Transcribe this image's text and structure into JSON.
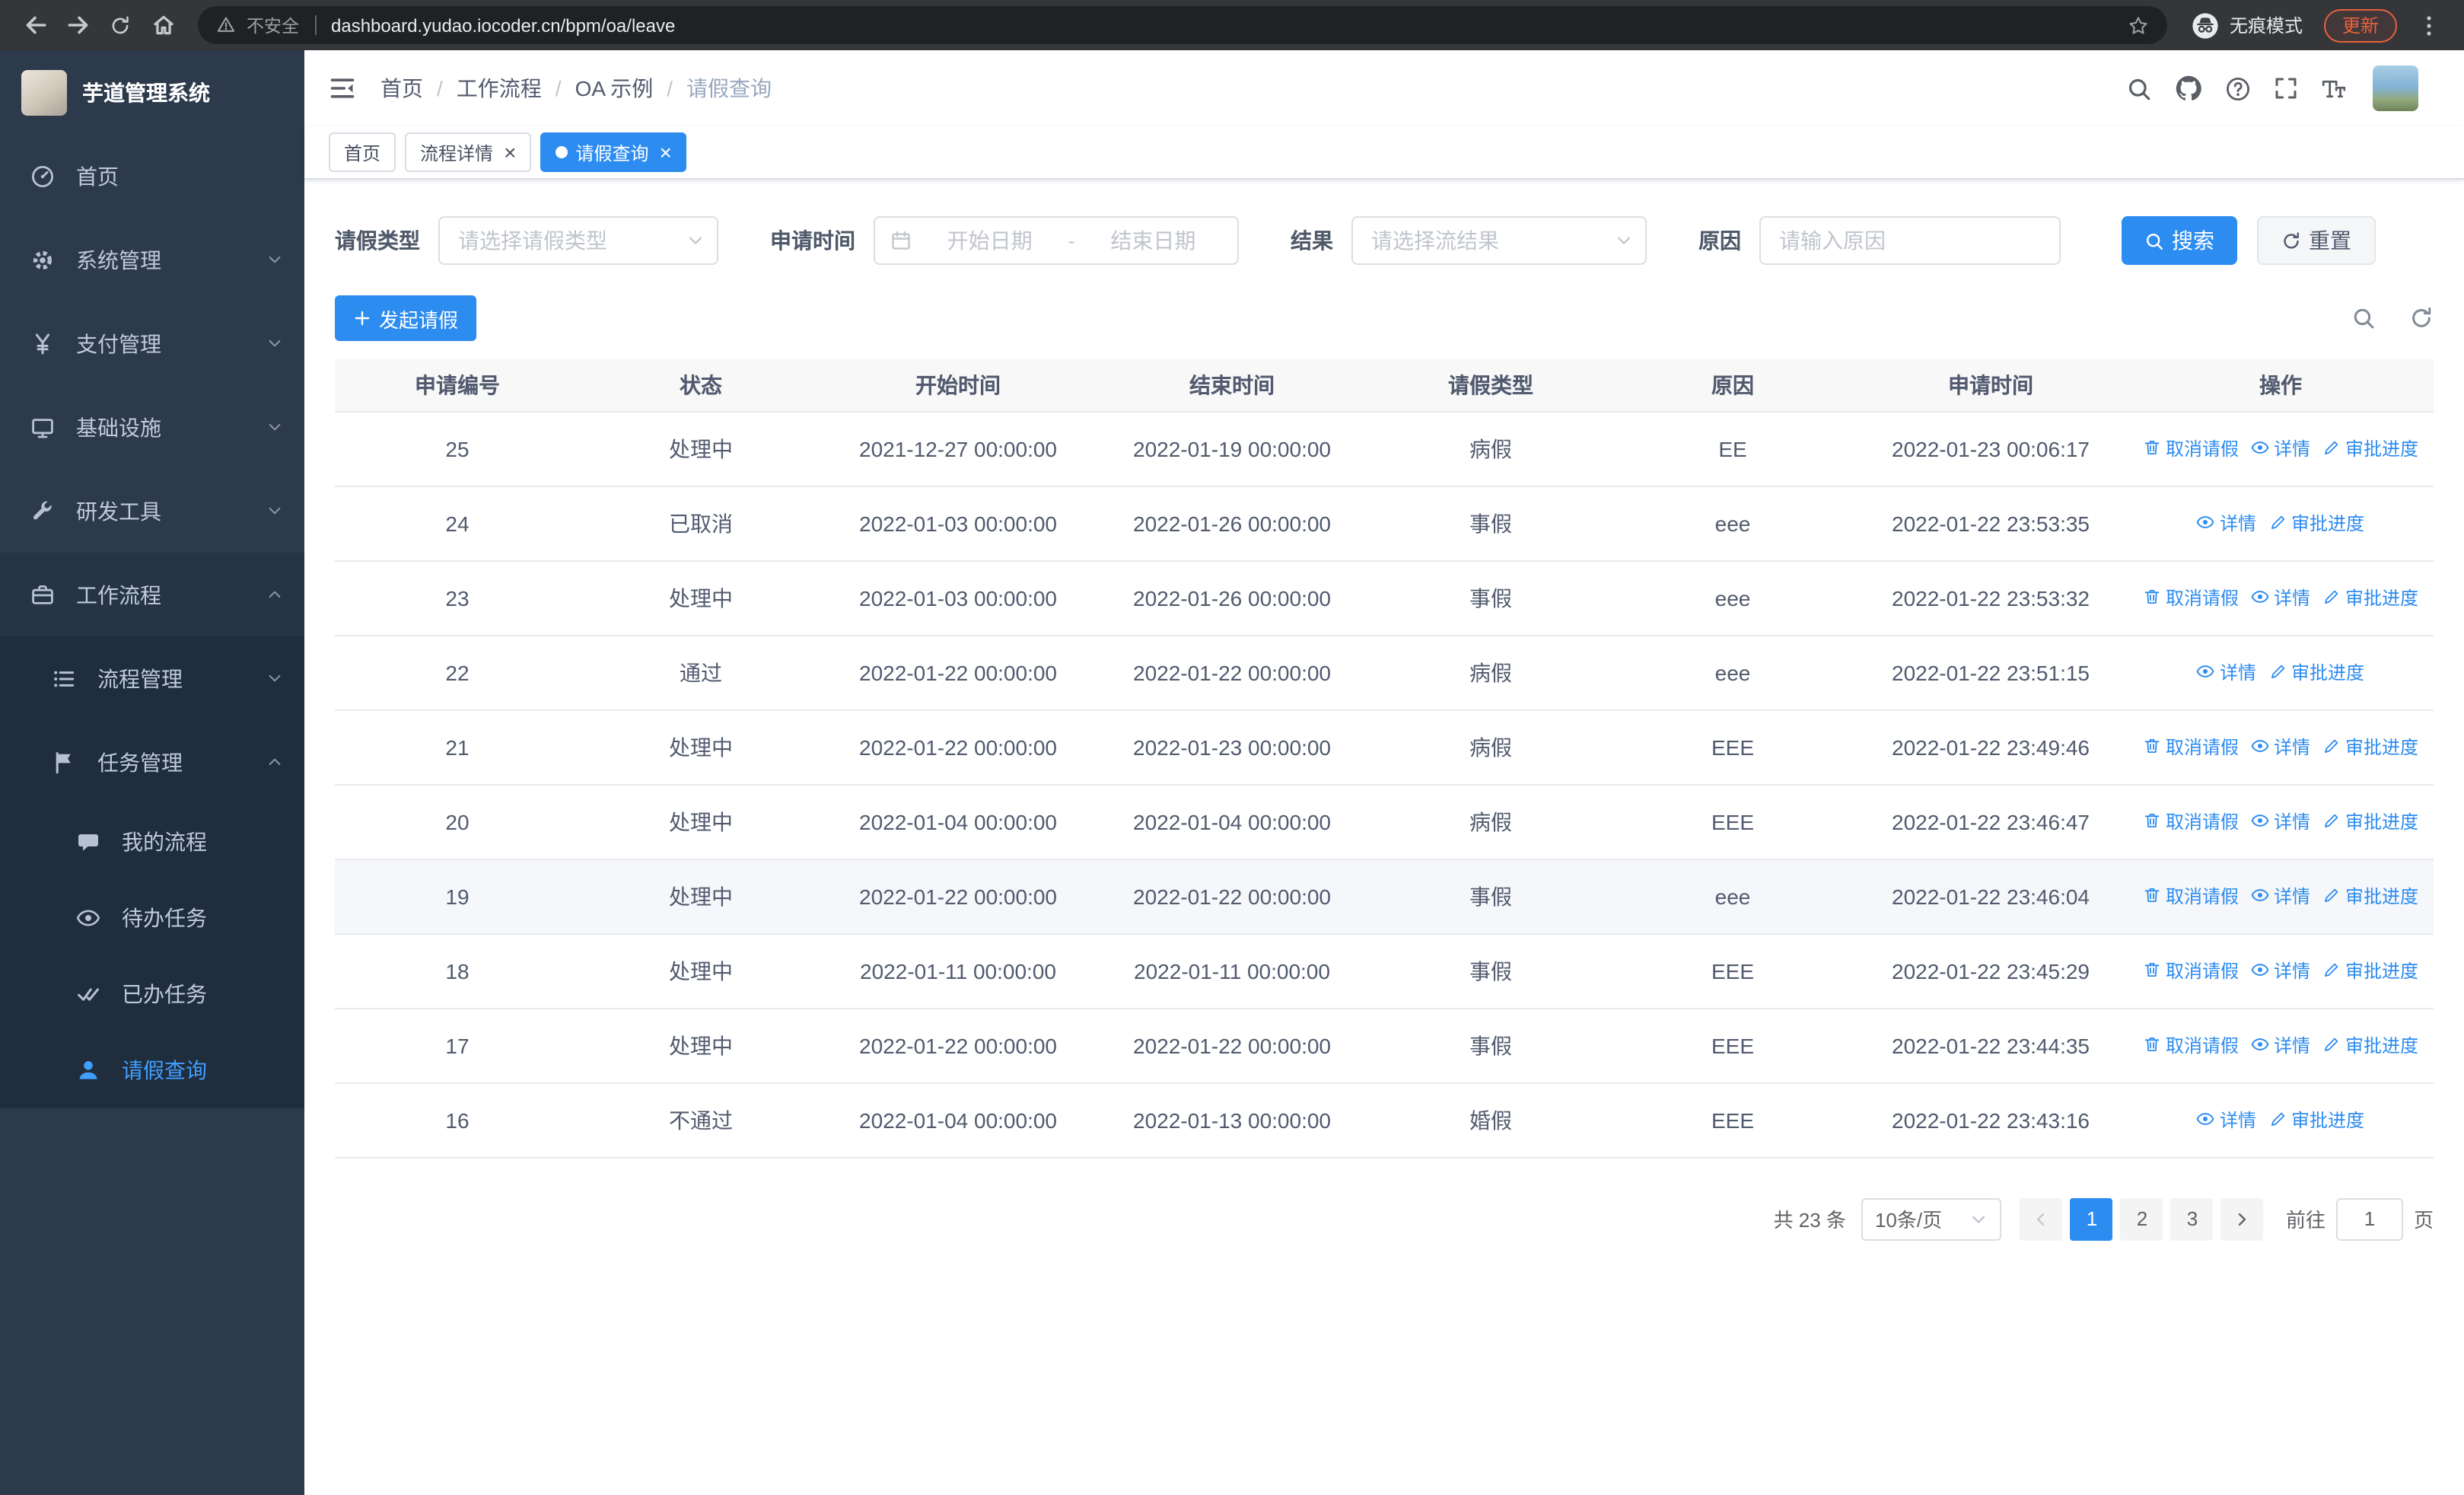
{
  "colors": {
    "primary": "#2d8cf0",
    "sidebar_active": "#409eff",
    "update": "#e8603c"
  },
  "browser": {
    "security_label": "不安全",
    "url": "dashboard.yudao.iocoder.cn/bpm/oa/leave",
    "incognito_label": "无痕模式",
    "update_label": "更新"
  },
  "sidebar": {
    "logo_title": "芋道管理系统",
    "items": [
      {
        "key": "home",
        "label": "首页",
        "icon": "dashboard-icon",
        "expandable": false,
        "expanded": false
      },
      {
        "key": "system",
        "label": "系统管理",
        "icon": "gear-icon",
        "expandable": true,
        "expanded": false
      },
      {
        "key": "payment",
        "label": "支付管理",
        "icon": "yen-icon",
        "expandable": true,
        "expanded": false
      },
      {
        "key": "infrastructure",
        "label": "基础设施",
        "icon": "infra-icon",
        "expandable": true,
        "expanded": false
      },
      {
        "key": "dev-tools",
        "label": "研发工具",
        "icon": "tools-icon",
        "expandable": true,
        "expanded": false
      },
      {
        "key": "workflow",
        "label": "工作流程",
        "icon": "workflow-icon",
        "expandable": true,
        "expanded": true
      }
    ],
    "workflow_children": [
      {
        "key": "process-management",
        "label": "流程管理",
        "icon": "process-icon",
        "expanded": false
      },
      {
        "key": "task-management",
        "label": "任务管理",
        "icon": "task-icon",
        "expanded": true
      }
    ],
    "task_children": [
      {
        "key": "my-process",
        "label": "我的流程",
        "icon": "chat-icon",
        "active": false
      },
      {
        "key": "todo-tasks",
        "label": "待办任务",
        "icon": "eye-icon",
        "active": false
      },
      {
        "key": "done-tasks",
        "label": "已办任务",
        "icon": "done-tasks-icon",
        "active": false
      },
      {
        "key": "leave-query",
        "label": "请假查询",
        "icon": "user-icon",
        "active": true
      }
    ]
  },
  "header": {
    "breadcrumb": [
      "首页",
      "工作流程",
      "OA 示例",
      "请假查询"
    ],
    "breadcrumb_separator": "/"
  },
  "tabs": [
    {
      "key": "home",
      "label": "首页",
      "closable": false,
      "active": false
    },
    {
      "key": "process-detail",
      "label": "流程详情",
      "closable": true,
      "active": false
    },
    {
      "key": "leave-query",
      "label": "请假查询",
      "closable": true,
      "active": true
    }
  ],
  "filters": {
    "leave_type_label": "请假类型",
    "leave_type_placeholder": "请选择请假类型",
    "apply_time_label": "申请时间",
    "date_start_placeholder": "开始日期",
    "date_separator": "-",
    "date_end_placeholder": "结束日期",
    "result_label": "结果",
    "result_placeholder": "请选择流结果",
    "reason_label": "原因",
    "reason_placeholder": "请输入原因",
    "search_button": "搜索",
    "reset_button": "重置"
  },
  "toolbar": {
    "create_label": "发起请假"
  },
  "table": {
    "columns": [
      "申请编号",
      "状态",
      "开始时间",
      "结束时间",
      "请假类型",
      "原因",
      "申请时间",
      "操作"
    ],
    "action_labels": {
      "cancel": "取消请假",
      "detail": "详情",
      "progress": "审批进度"
    },
    "action_icons": {
      "cancel": "delete-icon",
      "detail": "eye-icon",
      "progress": "edit-icon"
    },
    "rows": [
      {
        "id": "25",
        "status": "处理中",
        "start_time": "2021-12-27 00:00:00",
        "end_time": "2022-01-19 00:00:00",
        "leave_type": "病假",
        "reason": "EE",
        "apply_time": "2022-01-23 00:06:17",
        "actions": [
          "cancel",
          "detail",
          "progress"
        ]
      },
      {
        "id": "24",
        "status": "已取消",
        "start_time": "2022-01-03 00:00:00",
        "end_time": "2022-01-26 00:00:00",
        "leave_type": "事假",
        "reason": "eee",
        "apply_time": "2022-01-22 23:53:35",
        "actions": [
          "detail",
          "progress"
        ]
      },
      {
        "id": "23",
        "status": "处理中",
        "start_time": "2022-01-03 00:00:00",
        "end_time": "2022-01-26 00:00:00",
        "leave_type": "事假",
        "reason": "eee",
        "apply_time": "2022-01-22 23:53:32",
        "actions": [
          "cancel",
          "detail",
          "progress"
        ]
      },
      {
        "id": "22",
        "status": "通过",
        "start_time": "2022-01-22 00:00:00",
        "end_time": "2022-01-22 00:00:00",
        "leave_type": "病假",
        "reason": "eee",
        "apply_time": "2022-01-22 23:51:15",
        "actions": [
          "detail",
          "progress"
        ]
      },
      {
        "id": "21",
        "status": "处理中",
        "start_time": "2022-01-22 00:00:00",
        "end_time": "2022-01-23 00:00:00",
        "leave_type": "病假",
        "reason": "EEE",
        "apply_time": "2022-01-22 23:49:46",
        "actions": [
          "cancel",
          "detail",
          "progress"
        ]
      },
      {
        "id": "20",
        "status": "处理中",
        "start_time": "2022-01-04 00:00:00",
        "end_time": "2022-01-04 00:00:00",
        "leave_type": "病假",
        "reason": "EEE",
        "apply_time": "2022-01-22 23:46:47",
        "actions": [
          "cancel",
          "detail",
          "progress"
        ]
      },
      {
        "id": "19",
        "status": "处理中",
        "start_time": "2022-01-22 00:00:00",
        "end_time": "2022-01-22 00:00:00",
        "leave_type": "事假",
        "reason": "eee",
        "apply_time": "2022-01-22 23:46:04",
        "actions": [
          "cancel",
          "detail",
          "progress"
        ],
        "highlighted": true
      },
      {
        "id": "18",
        "status": "处理中",
        "start_time": "2022-01-11 00:00:00",
        "end_time": "2022-01-11 00:00:00",
        "leave_type": "事假",
        "reason": "EEE",
        "apply_time": "2022-01-22 23:45:29",
        "actions": [
          "cancel",
          "detail",
          "progress"
        ]
      },
      {
        "id": "17",
        "status": "处理中",
        "start_time": "2022-01-22 00:00:00",
        "end_time": "2022-01-22 00:00:00",
        "leave_type": "事假",
        "reason": "EEE",
        "apply_time": "2022-01-22 23:44:35",
        "actions": [
          "cancel",
          "detail",
          "progress"
        ]
      },
      {
        "id": "16",
        "status": "不通过",
        "start_time": "2022-01-04 00:00:00",
        "end_time": "2022-01-13 00:00:00",
        "leave_type": "婚假",
        "reason": "EEE",
        "apply_time": "2022-01-22 23:43:16",
        "actions": [
          "detail",
          "progress"
        ]
      }
    ]
  },
  "pagination": {
    "total_text": "共 23 条",
    "page_size_label": "10条/页",
    "pages": [
      "1",
      "2",
      "3"
    ],
    "active_page": "1",
    "goto_label": "前往",
    "goto_value": "1",
    "goto_unit": "页"
  }
}
